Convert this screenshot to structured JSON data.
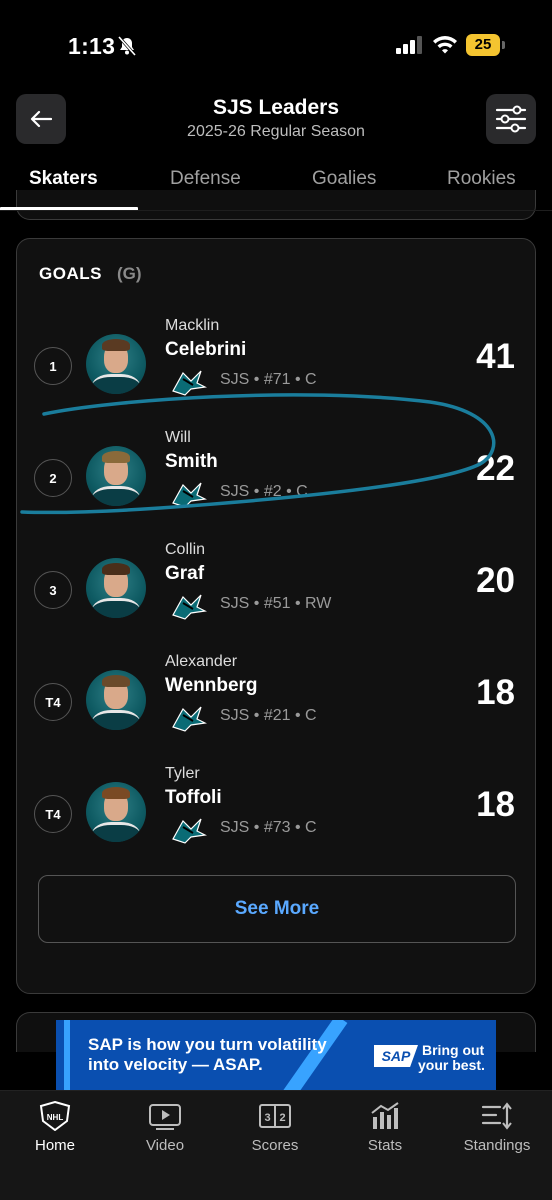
{
  "status_bar": {
    "time": "1:13",
    "battery": "25"
  },
  "header": {
    "title": "SJS Leaders",
    "subtitle": "2025-26 Regular Season"
  },
  "tabs": [
    {
      "label": "Skaters",
      "active": true
    },
    {
      "label": "Defense",
      "active": false
    },
    {
      "label": "Goalies",
      "active": false
    },
    {
      "label": "Rookies",
      "active": false
    }
  ],
  "goals_card": {
    "title": "GOALS",
    "abbr": "(G)",
    "players": [
      {
        "rank": "1",
        "first": "Macklin",
        "last": "Celebrini",
        "meta": "SJS • #71 • C",
        "value": "41"
      },
      {
        "rank": "2",
        "first": "Will",
        "last": "Smith",
        "meta": "SJS • #2 • C",
        "value": "22"
      },
      {
        "rank": "3",
        "first": "Collin",
        "last": "Graf",
        "meta": "SJS • #51 • RW",
        "value": "20"
      },
      {
        "rank": "T4",
        "first": "Alexander",
        "last": "Wennberg",
        "meta": "SJS • #21 • C",
        "value": "18"
      },
      {
        "rank": "T4",
        "first": "Tyler",
        "last": "Toffoli",
        "meta": "SJS • #73 • C",
        "value": "18"
      }
    ],
    "see_more": "See More"
  },
  "ad": {
    "line1": "SAP is how you turn volatility",
    "line2": "into velocity — ASAP.",
    "logo": "SAP",
    "tagline1": "Bring out",
    "tagline2": "your best."
  },
  "bottom_nav": [
    {
      "label": "Home",
      "icon": "nhl-shield-icon",
      "active": true
    },
    {
      "label": "Video",
      "icon": "video-play-icon",
      "active": false
    },
    {
      "label": "Scores",
      "icon": "scoreboard-icon",
      "active": false
    },
    {
      "label": "Stats",
      "icon": "bar-chart-icon",
      "active": false
    },
    {
      "label": "Standings",
      "icon": "standings-sort-icon",
      "active": false
    }
  ],
  "colors": {
    "accent_link": "#5aa9ff",
    "annotation": "#1a7d9c",
    "battery": "#f4c430",
    "ad_background": "#0a4fb0"
  }
}
